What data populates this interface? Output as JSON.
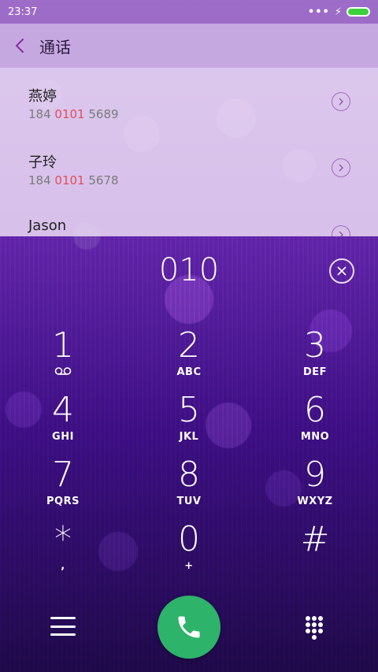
{
  "status": {
    "time": "23:37",
    "signal_dots": "•••",
    "charge_icon": "⚡"
  },
  "header": {
    "back_icon": "chevron-left-icon",
    "title": "通话"
  },
  "suggestions": [
    {
      "name": "燕婷",
      "number_prefix": "184 ",
      "number_match": "0101",
      "number_suffix": " 5689"
    },
    {
      "name": "子玲",
      "number_prefix": "184 ",
      "number_match": "0101",
      "number_suffix": " 5678"
    },
    {
      "name": "Jason"
    }
  ],
  "dial": {
    "digits": "010"
  },
  "keypad": [
    {
      "num": "1",
      "letters": ""
    },
    {
      "num": "2",
      "letters": "ABC"
    },
    {
      "num": "3",
      "letters": "DEF"
    },
    {
      "num": "4",
      "letters": "GHI"
    },
    {
      "num": "5",
      "letters": "JKL"
    },
    {
      "num": "6",
      "letters": "MNO"
    },
    {
      "num": "7",
      "letters": "PQRS"
    },
    {
      "num": "8",
      "letters": "TUV"
    },
    {
      "num": "9",
      "letters": "WXYZ"
    },
    {
      "num": "*",
      "letters": ","
    },
    {
      "num": "0",
      "letters": "+"
    },
    {
      "num": "#",
      "letters": ""
    }
  ],
  "colors": {
    "call_button": "#2db36a",
    "highlight": "#e24d5a",
    "header": "#c6a8e1"
  }
}
